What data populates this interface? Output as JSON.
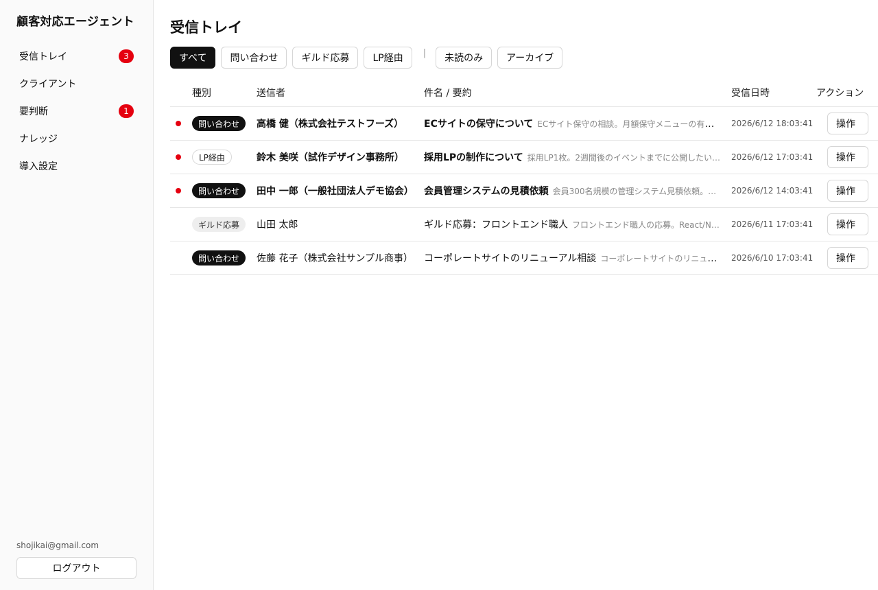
{
  "app": {
    "title": "顧客対応エージェント"
  },
  "sidebar": {
    "items": [
      {
        "label": "受信トレイ",
        "badge": "3"
      },
      {
        "label": "クライアント",
        "badge": ""
      },
      {
        "label": "要判断",
        "badge": "1"
      },
      {
        "label": "ナレッジ",
        "badge": ""
      },
      {
        "label": "導入設定",
        "badge": ""
      }
    ],
    "email": "shojikai@gmail.com",
    "logout_label": "ログアウト"
  },
  "main": {
    "title": "受信トレイ",
    "filters": {
      "all": "すべて",
      "inquiry": "問い合わせ",
      "guild": "ギルド応募",
      "lp": "LP経由",
      "separator": "|",
      "unread": "未読のみ",
      "archive": "アーカイブ"
    },
    "table": {
      "headers": {
        "type": "種別",
        "sender": "送信者",
        "subject": "件名 / 要約",
        "date": "受信日時",
        "action": "アクション"
      },
      "action_label": "操作",
      "rows": [
        {
          "unread": true,
          "type": "問い合わせ",
          "type_style": "dark",
          "sender": "高橋 健（株式会社テストフーズ）",
          "subject": "ECサイトの保守について",
          "summary": "ECサイト保守の相談。月額保守メニューの有無…",
          "date": "2026/6/12 18:03:41"
        },
        {
          "unread": true,
          "type": "LP経由",
          "type_style": "outline",
          "sender": "鈴木 美咲（試作デザイン事務所）",
          "subject": "採用LPの制作について",
          "summary": "採用LP1枚。2週間後のイベントまでに公開したい…",
          "date": "2026/6/12 17:03:41"
        },
        {
          "unread": true,
          "type": "問い合わせ",
          "type_style": "dark",
          "sender": "田中 一郎（一般社団法人デモ協会）",
          "subject": "会員管理システムの見積依頼",
          "summary": "会員300名規模の管理システム見積依頼。…",
          "date": "2026/6/12 14:03:41"
        },
        {
          "unread": false,
          "type": "ギルド応募",
          "type_style": "gray",
          "sender": "山田 太郎",
          "subject": "ギルド応募：フロントエンド職人",
          "summary": "フロントエンド職人の応募。React/N…",
          "date": "2026/6/11 17:03:41"
        },
        {
          "unread": false,
          "type": "問い合わせ",
          "type_style": "dark",
          "sender": "佐藤 花子（株式会社サンプル商事）",
          "subject": "コーポレートサイトのリニューアル相談",
          "summary": "コーポレートサイトのリニュー…",
          "date": "2026/6/10 17:03:41"
        }
      ]
    }
  }
}
